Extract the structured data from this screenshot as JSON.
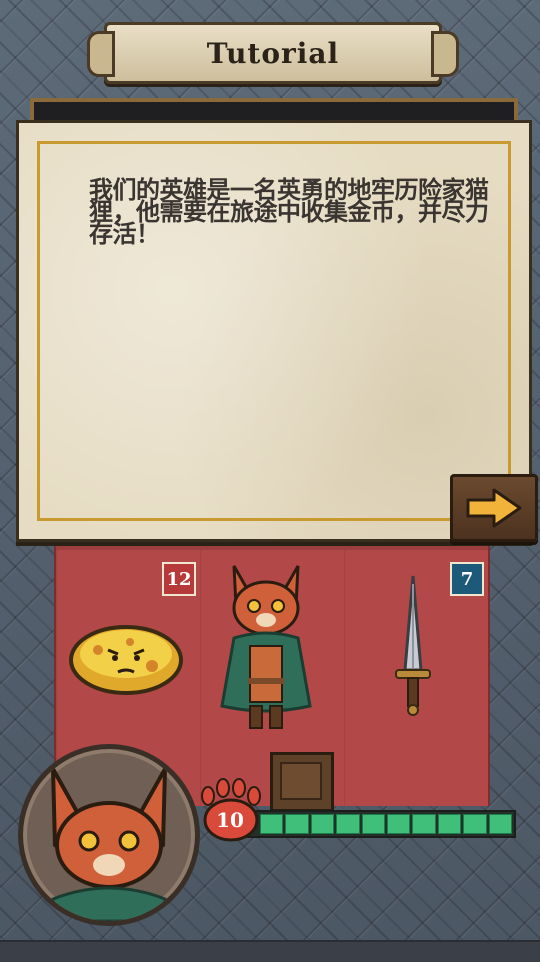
{
  "title": "Tutorial",
  "dialog": {
    "text": "我们的英雄是一名英勇的地牢历险家猫狸，他需要在旅途中收集金币，并尽力存活！"
  },
  "board": {
    "enemy_value": "12",
    "weapon_value": "7"
  },
  "player": {
    "health": "10",
    "health_max_segments": 10
  },
  "icons": {
    "next": "arrow-right-icon",
    "enemy": "slime-icon",
    "hero": "cat-hero-icon",
    "weapon": "dagger-icon",
    "health": "paw-icon",
    "portrait": "cat-portrait"
  },
  "colors": {
    "parchment": "#e6dcc3",
    "gold_border": "#c99a2f",
    "board_red": "#b24848",
    "hp_green": "#3fbf7a",
    "badge_red": "#b63a3a",
    "badge_blue": "#1d5a7a"
  }
}
